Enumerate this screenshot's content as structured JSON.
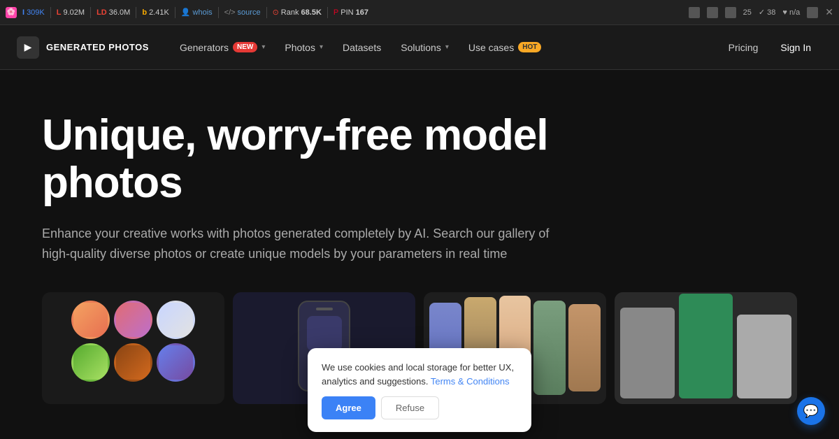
{
  "browser": {
    "favicon": "🌸",
    "stats": [
      {
        "prefix": "I",
        "value": "309K",
        "color": "g-color"
      },
      {
        "prefix": "L",
        "value": "9.02M",
        "color": "o-color"
      },
      {
        "prefix": "LD",
        "value": "36.0M",
        "color": "o-color"
      },
      {
        "prefix": "b",
        "value": "2.41K",
        "color": "b-color"
      },
      {
        "label": "whois",
        "color": "default"
      },
      {
        "label": "source",
        "color": "default"
      },
      {
        "prefix": "Rank",
        "value": "68.5K",
        "color": "r-color"
      },
      {
        "prefix": "PIN",
        "value": "167",
        "color": "p-color"
      }
    ],
    "toolbar_right": {
      "score_25": "25",
      "score_38": "38",
      "score_na": "n/a"
    }
  },
  "navbar": {
    "logo_icon": "▶",
    "logo_text": "GENERATED PHOTOS",
    "nav_items": [
      {
        "label": "Generators",
        "badge": "New",
        "badge_type": "new",
        "has_chevron": true
      },
      {
        "label": "Photos",
        "has_chevron": true
      },
      {
        "label": "Datasets"
      },
      {
        "label": "Solutions",
        "has_chevron": true
      },
      {
        "label": "Use cases",
        "badge": "Hot",
        "badge_type": "hot"
      }
    ],
    "pricing_label": "Pricing",
    "signin_label": "Sign In"
  },
  "hero": {
    "title": "Unique, worry-free model photos",
    "subtitle": "Enhance your creative works with photos generated completely by AI. Search our gallery of high-quality diverse photos or create unique models by your parameters in real time"
  },
  "cookie": {
    "text": "We use cookies and local storage for better UX, analytics and suggestions.",
    "link_text": "Terms & Conditions",
    "agree_label": "Agree",
    "refuse_label": "Refuse"
  },
  "chat": {
    "icon": "💬"
  }
}
